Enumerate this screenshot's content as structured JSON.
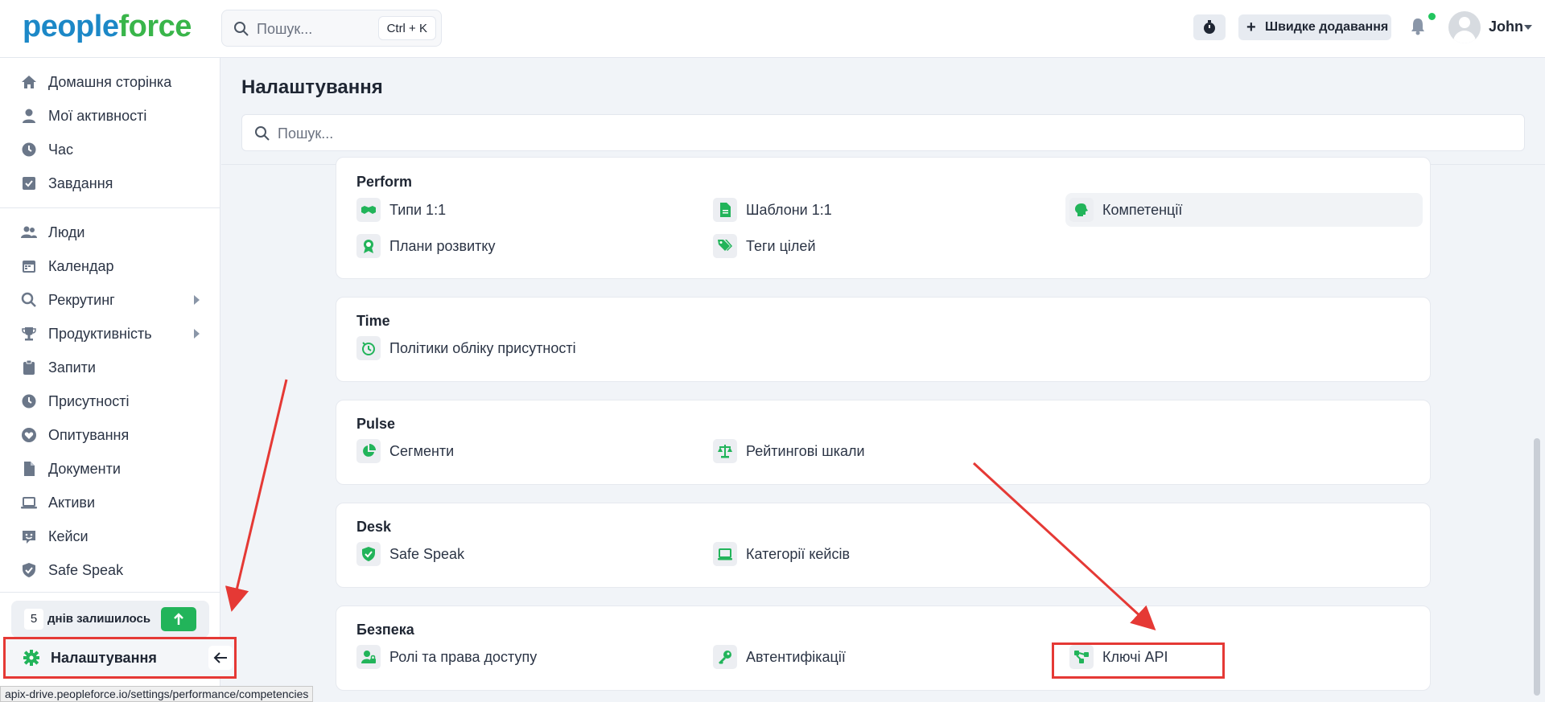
{
  "brand": {
    "logo_part1": "people",
    "logo_part2": "force"
  },
  "topbar": {
    "search_placeholder": "Пошук...",
    "search_shortcut": "Ctrl + K",
    "quick_add_label": "Швидке додавання",
    "user_name": "John"
  },
  "sidebar": {
    "items_top": [
      {
        "label": "Домашня сторінка",
        "icon": "home-icon"
      },
      {
        "label": "Мої активності",
        "icon": "user-icon"
      },
      {
        "label": "Час",
        "icon": "clock-icon"
      },
      {
        "label": "Завдання",
        "icon": "checkbox-icon"
      }
    ],
    "items_main": [
      {
        "label": "Люди",
        "icon": "people-icon"
      },
      {
        "label": "Календар",
        "icon": "calendar-icon"
      },
      {
        "label": "Рекрутинг",
        "icon": "search-icon",
        "has_submenu": true
      },
      {
        "label": "Продуктивність",
        "icon": "trophy-icon",
        "has_submenu": true
      },
      {
        "label": "Запити",
        "icon": "clipboard-icon"
      },
      {
        "label": "Присутності",
        "icon": "clock-icon"
      },
      {
        "label": "Опитування",
        "icon": "heart-icon"
      },
      {
        "label": "Документи",
        "icon": "file-icon"
      },
      {
        "label": "Активи",
        "icon": "laptop-icon"
      },
      {
        "label": "Кейси",
        "icon": "support-icon"
      },
      {
        "label": "Safe Speak",
        "icon": "shield-icon"
      }
    ],
    "trial": {
      "days": "5",
      "text": "днів залишилось"
    },
    "settings_label": "Налаштування"
  },
  "status_url": "apix-drive.peopleforce.io/settings/performance/competencies",
  "main": {
    "title": "Налаштування",
    "search_placeholder": "Пошук...",
    "sections": [
      {
        "title": "Perform",
        "items": [
          "Типи 1:1",
          "Шаблони 1:1",
          "Компетенції",
          "Плани розвитку",
          "Теги цілей"
        ]
      },
      {
        "title": "Time",
        "items": [
          "Політики обліку присутності"
        ]
      },
      {
        "title": "Pulse",
        "items": [
          "Сегменти",
          "Рейтингові шкали"
        ]
      },
      {
        "title": "Desk",
        "items": [
          "Safe Speak",
          "Категорії кейсів"
        ]
      },
      {
        "title": "Безпека",
        "items": [
          "Ролі та права доступу",
          "Автентифікації",
          "Ключі API"
        ]
      }
    ]
  },
  "colors": {
    "accent_green": "#22b45a",
    "annotation_red": "#e53935",
    "brand_blue": "#1c88c7"
  }
}
